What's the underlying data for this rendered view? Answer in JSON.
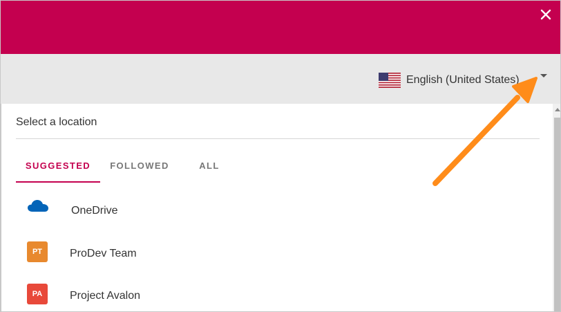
{
  "window": {
    "close_icon": "close-icon",
    "header_color": "#c4004f"
  },
  "language": {
    "flag_icon": "us-flag-icon",
    "selected": "English (United States)",
    "caret_icon": "caret-down-icon"
  },
  "panel": {
    "title": "Select a location"
  },
  "tabs": [
    {
      "label": "SUGGESTED",
      "active": true
    },
    {
      "label": "FOLLOWED",
      "active": false
    },
    {
      "label": "ALL",
      "active": false
    }
  ],
  "locations": [
    {
      "label": "OneDrive",
      "icon": "onedrive-cloud-icon",
      "icon_color": "#0364b8"
    },
    {
      "label": "ProDev Team",
      "icon_text": "PT",
      "icon_color": "#e8892e"
    },
    {
      "label": "Project Avalon",
      "icon_text": "PA",
      "icon_color": "#e8493a"
    }
  ],
  "annotation": {
    "arrow_color": "#ff8c1a"
  }
}
